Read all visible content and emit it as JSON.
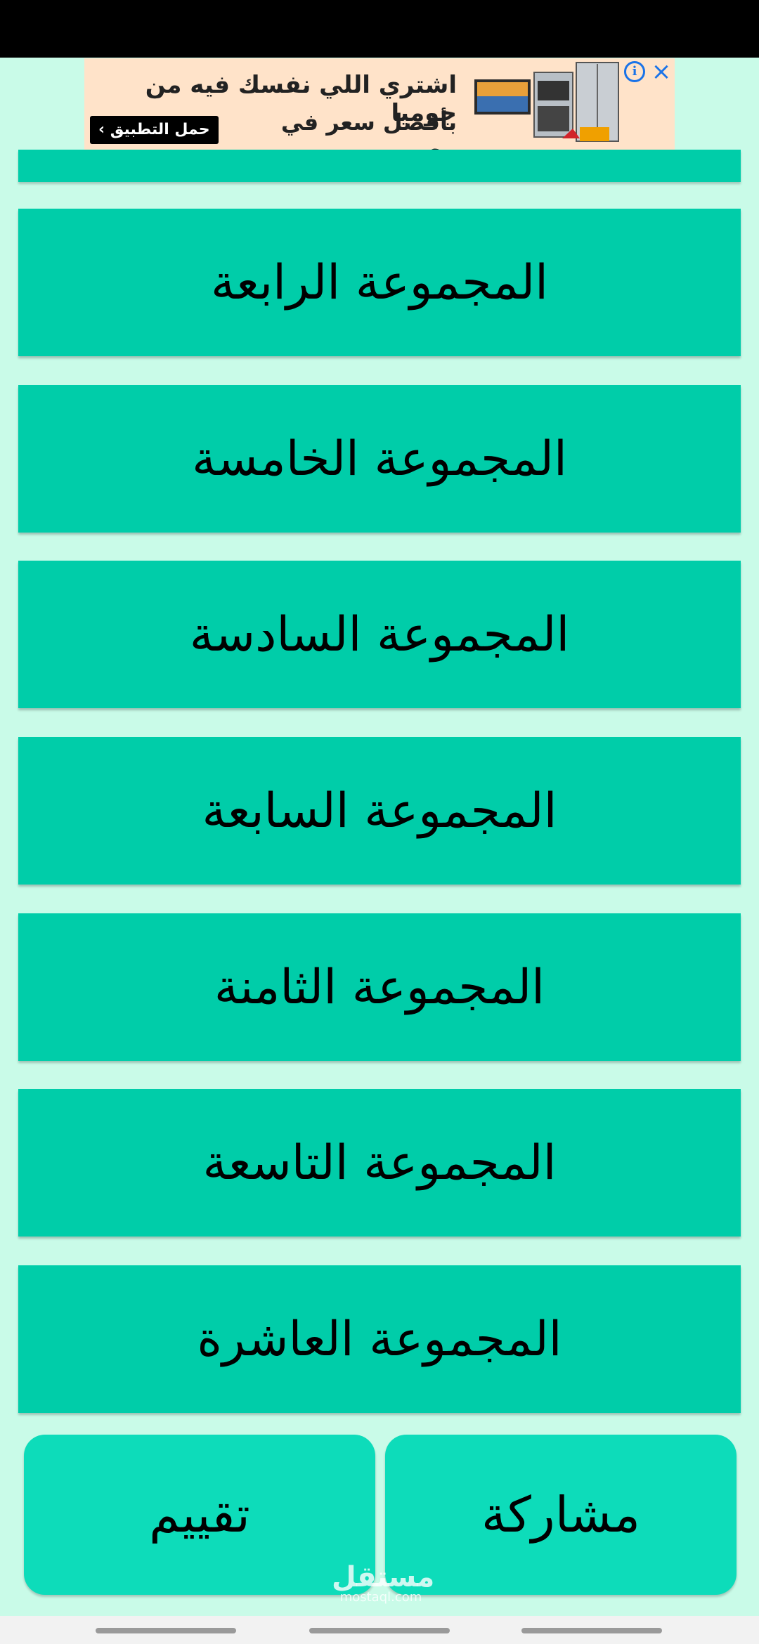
{
  "ad": {
    "headline": "اشتري اللي نفسك فيه من جوميا",
    "subline": "بأفضل سعر في مصر",
    "cta": "حمل التطبيق ›",
    "info_icon": "i",
    "close_icon": "×"
  },
  "groups": [
    {
      "label": "المجموعة الرابعة"
    },
    {
      "label": "المجموعة الخامسة"
    },
    {
      "label": "المجموعة السادسة"
    },
    {
      "label": "المجموعة السابعة"
    },
    {
      "label": "المجموعة الثامنة"
    },
    {
      "label": "المجموعة التاسعة"
    },
    {
      "label": "المجموعة العاشرة"
    }
  ],
  "actions": {
    "rate_label": "تقييم",
    "share_label": "مشاركة"
  },
  "watermark": {
    "text": "مستقل",
    "sub": "mostaql.com"
  },
  "colors": {
    "background": "#c9fbe8",
    "tile": "#00cda9",
    "action_button": "#0ddcba"
  }
}
